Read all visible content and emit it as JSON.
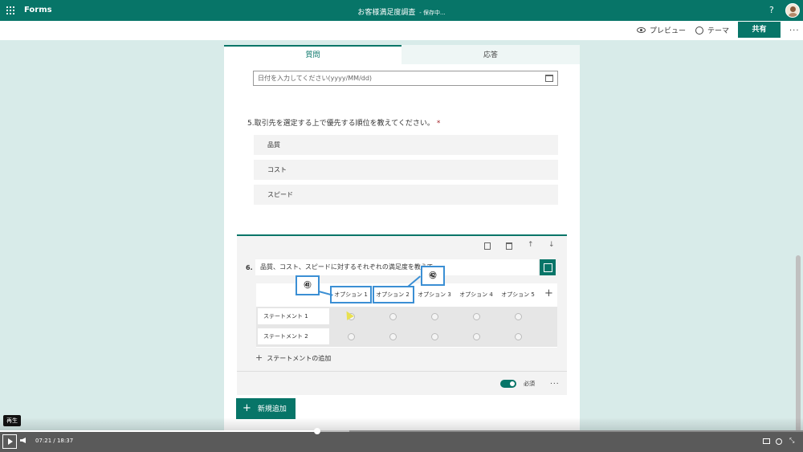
{
  "app": {
    "name": "Forms",
    "help": "?"
  },
  "document": {
    "title": "お客様満足度調査",
    "status": "- 保存中..."
  },
  "commands": {
    "preview": "プレビュー",
    "theme": "テーマ",
    "share": "共有",
    "more": "..."
  },
  "tabs": [
    {
      "label": "質問"
    },
    {
      "label": "応答"
    }
  ],
  "date_input": {
    "placeholder": "日付を入力してください(yyyy/MM/dd)"
  },
  "question5": {
    "title": "5.取引先を選定する上で優先する順位を教えてください。",
    "required_mark": "*",
    "items": [
      {
        "label": "品質"
      },
      {
        "label": "コスト"
      },
      {
        "label": "スピード"
      }
    ]
  },
  "question6": {
    "number": "6.",
    "text": "品質、コスト、スピードに対するそれぞれの満足度を教えて",
    "options": [
      "オプション 1",
      "オプション 2",
      "オプション 3",
      "オプション 4",
      "オプション 5"
    ],
    "add_option": "+",
    "statements": [
      "ステートメント 1",
      "ステートメント 2"
    ],
    "add_statement": "ステートメントの追加",
    "required_label": "必須",
    "more": "..."
  },
  "new_button": {
    "label": "新規追加"
  },
  "annotations": {
    "badge1": "㊶",
    "badge2": "㊷"
  },
  "player": {
    "tooltip": "再生",
    "time": "07:21 / 18:37",
    "progress": 0.395
  },
  "colors": {
    "brand": "#077568",
    "callout": "#3b8fd4"
  }
}
